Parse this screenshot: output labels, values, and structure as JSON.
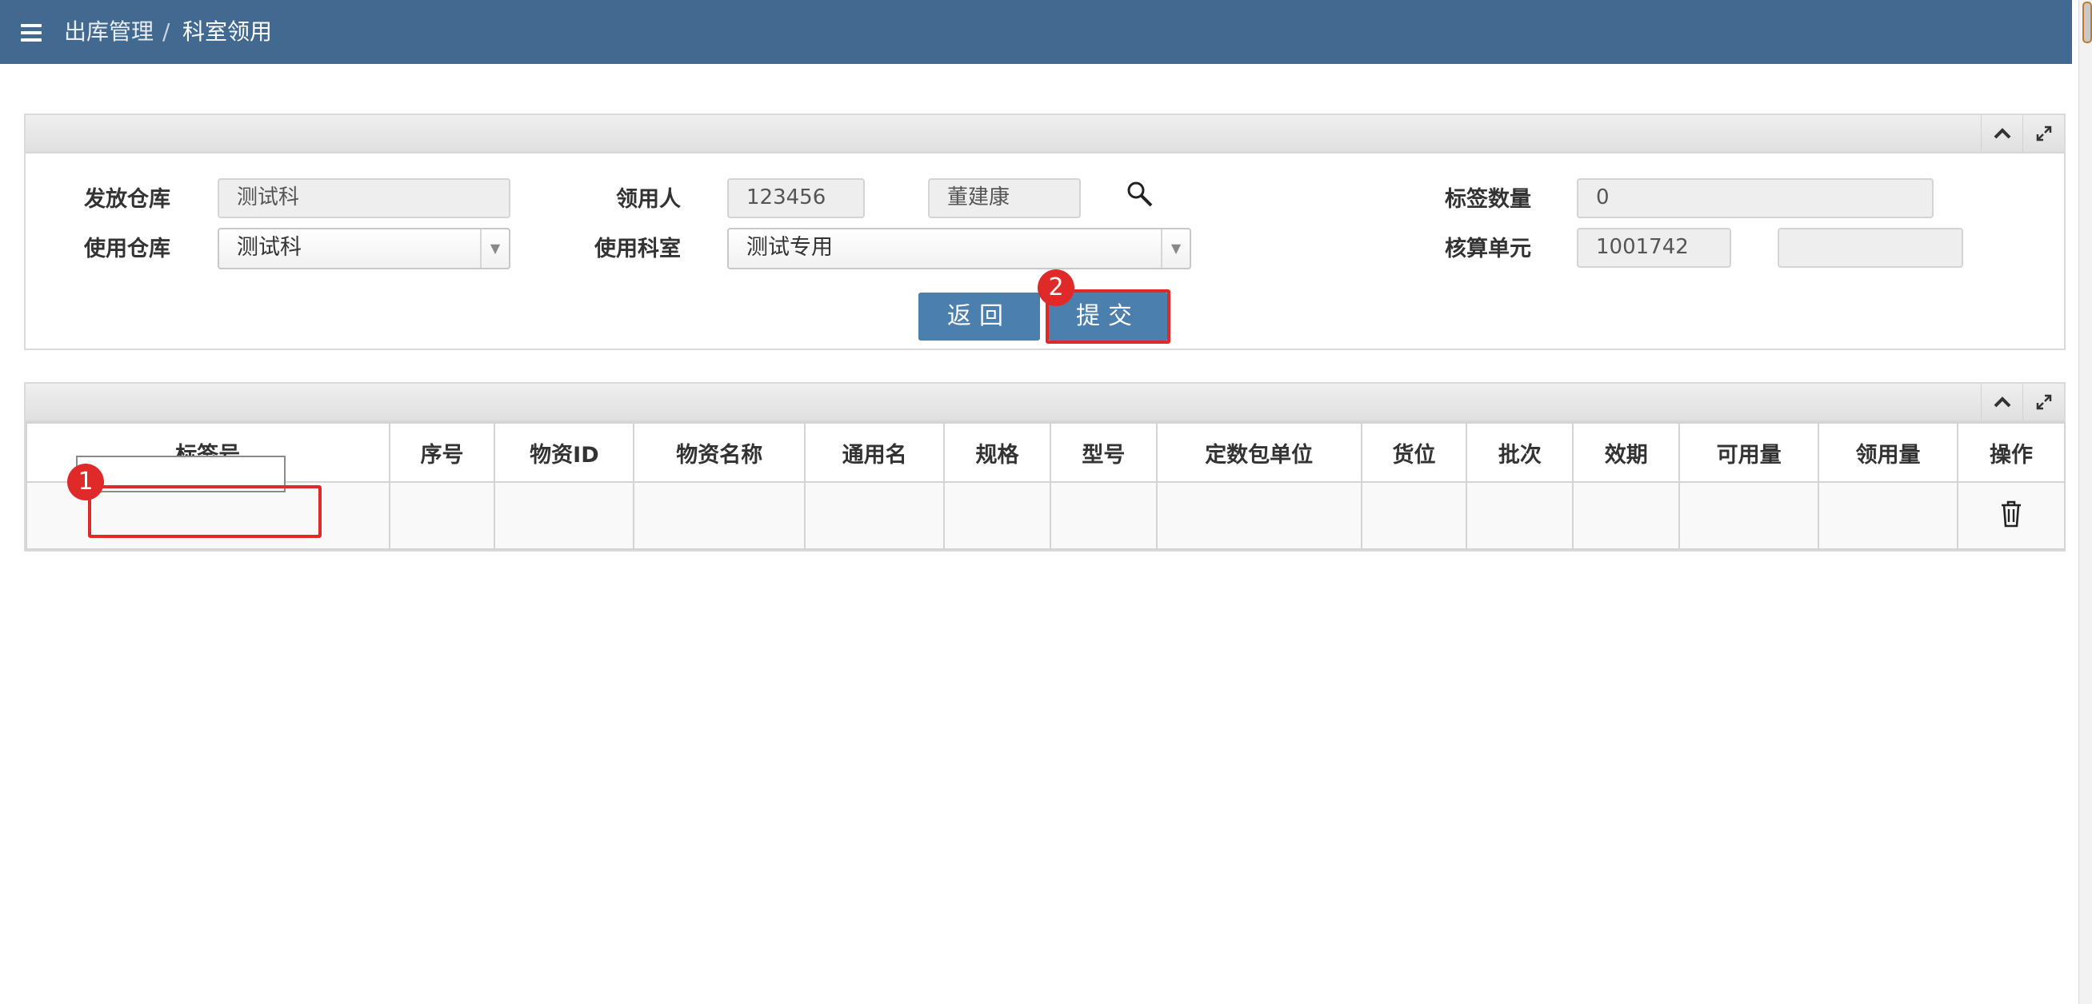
{
  "header": {
    "breadcrumb": [
      "出库管理",
      "科室领用"
    ],
    "separator": "/"
  },
  "form": {
    "issue_warehouse": {
      "label": "发放仓库",
      "value": "测试科"
    },
    "use_warehouse": {
      "label": "使用仓库",
      "value": "测试科"
    },
    "recipient": {
      "label": "领用人",
      "code": "123456",
      "name": "董建康"
    },
    "use_department": {
      "label": "使用科室",
      "value": "测试专用"
    },
    "tag_count": {
      "label": "标签数量",
      "value": "0"
    },
    "accounting_unit": {
      "label": "核算单元",
      "code": "1001742",
      "name": ""
    }
  },
  "buttons": {
    "back": "返回",
    "submit": "提交"
  },
  "annotations": {
    "badge_1": "1",
    "badge_2": "2"
  },
  "table": {
    "columns": [
      "标签号",
      "序号",
      "物资ID",
      "物资名称",
      "通用名",
      "规格",
      "型号",
      "定数包单位",
      "货位",
      "批次",
      "效期",
      "可用量",
      "领用量",
      "操作"
    ],
    "rows": [
      {
        "tag_no": "",
        "cells": [
          "",
          "",
          "",
          "",
          "",
          "",
          "",
          "",
          "",
          "",
          "",
          ""
        ]
      }
    ]
  },
  "icons": {
    "menu": "menu-icon",
    "collapse": "chevron-up-icon",
    "expand": "expand-icon",
    "search": "search-icon",
    "delete": "trash-icon"
  },
  "colors": {
    "topbar": "#42698f",
    "button": "#4a7fae",
    "highlight": "#e02a2a"
  }
}
